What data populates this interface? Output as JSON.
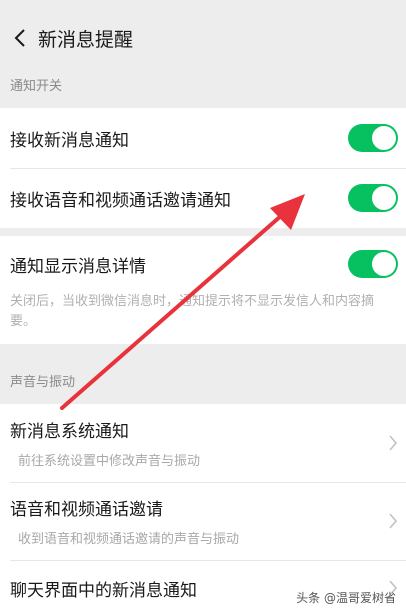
{
  "header": {
    "title": "新消息提醒"
  },
  "notify_section": {
    "label": "通知开关",
    "rows": [
      {
        "label": "接收新消息通知",
        "enabled": true
      },
      {
        "label": "接收语音和视频通话邀请通知",
        "enabled": true
      }
    ]
  },
  "details": {
    "label": "通知显示消息详情",
    "enabled": true,
    "description": "关闭后，当收到微信消息时，通知提示将不显示发信人和内容摘要。"
  },
  "sound_section": {
    "label": "声音与振动",
    "items": [
      {
        "title": "新消息系统通知",
        "subtitle": "前往系统设置中修改声音与振动"
      },
      {
        "title": "语音和视频通话邀请",
        "subtitle": "收到语音和视频通话邀请的声音与振动"
      },
      {
        "title": "聊天界面中的新消息通知",
        "subtitle": ""
      }
    ]
  },
  "watermark": "头条 @温哥爱树省",
  "colors": {
    "toggle_on": "#07c160",
    "arrow": "#e8323c",
    "background": "#ededed"
  },
  "icons": {
    "back": "chevron-left-icon",
    "nav": "chevron-right-icon"
  }
}
